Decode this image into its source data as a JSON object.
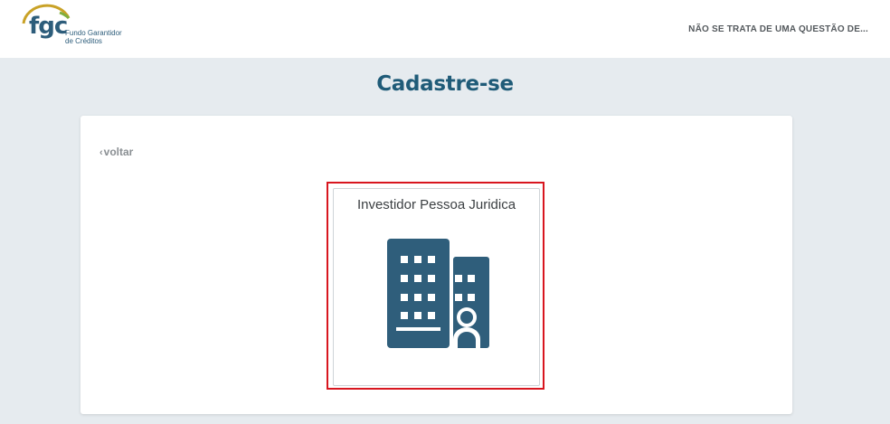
{
  "header": {
    "logo": {
      "text": "fgc",
      "line1": "Fundo Garantidor",
      "line2": "de Créditos",
      "icon": "fgc-logo"
    },
    "notice_link": "NÃO SE TRATA DE UMA QUESTÃO DE..."
  },
  "page": {
    "title": "Cadastre-se"
  },
  "card": {
    "back_chevron": "‹",
    "back_label": "voltar",
    "option": {
      "title": "Investidor Pessoa Juridica",
      "icon": "building-person-icon"
    }
  },
  "colors": {
    "background": "#e6ebef",
    "brand_blue": "#1f5b78",
    "icon_blue": "#2f5e7b",
    "logo_arc": "#c9a227",
    "highlight_red": "#d8161f"
  }
}
